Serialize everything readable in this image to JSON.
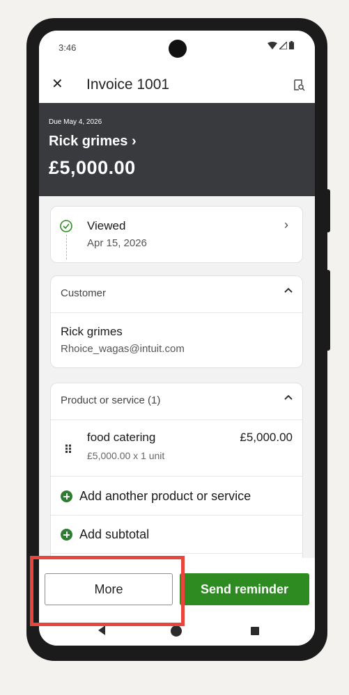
{
  "status_bar": {
    "time": "3:46"
  },
  "title_bar": {
    "close_glyph": "✕",
    "title": "Invoice 1001",
    "preview_icon": "preview-icon"
  },
  "header": {
    "due": "Due May 4, 2026",
    "customer_name": "Rick grimes",
    "customer_chevron": "›",
    "amount": "£5,000.00"
  },
  "status_card": {
    "title": "Viewed",
    "date": "Apr 15, 2026",
    "chevron": "›"
  },
  "customer_section": {
    "heading": "Customer",
    "name": "Rick grimes",
    "email": "Rhoice_wagas@intuit.com"
  },
  "product_section": {
    "heading": "Product or service (1)",
    "items": [
      {
        "name": "food catering",
        "detail": "£5,000.00 x 1 unit",
        "price": "£5,000.00"
      }
    ],
    "add_product_label": "Add another product or service",
    "add_subtotal_label": "Add subtotal"
  },
  "actions": {
    "more_label": "More",
    "send_label": "Send reminder"
  },
  "colors": {
    "accent_green": "#2e8b22",
    "header_bg": "#393a3d",
    "highlight": "#e8453c"
  }
}
